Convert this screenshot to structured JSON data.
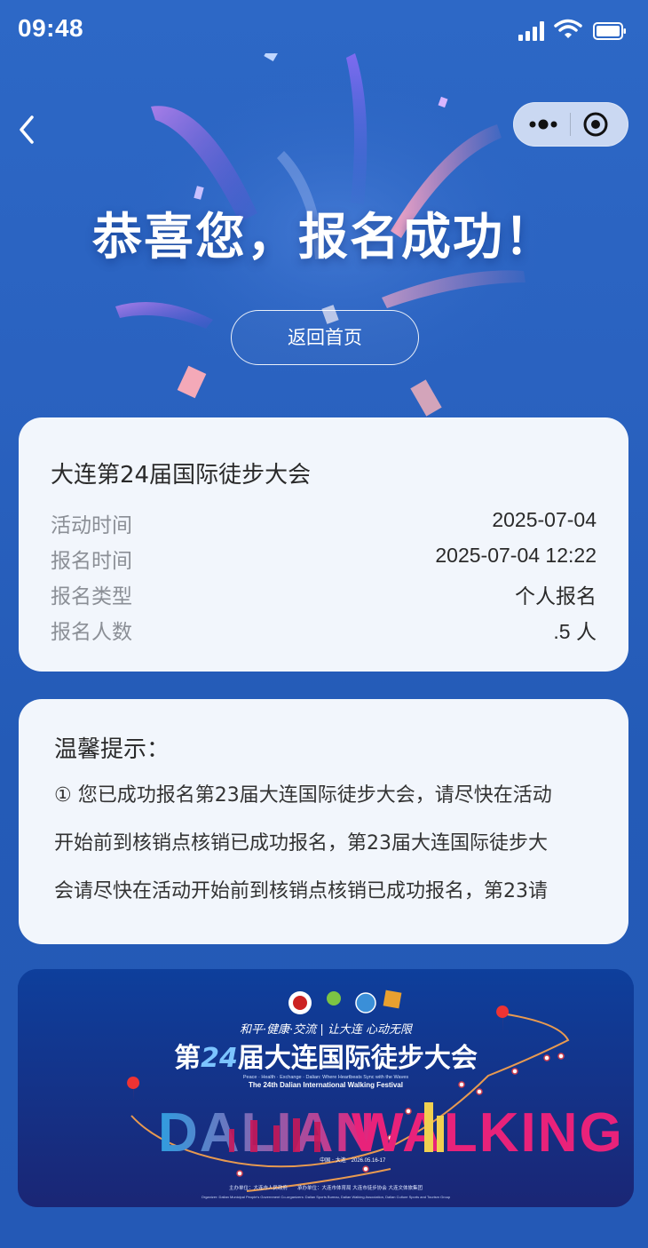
{
  "status_bar": {
    "time": "09:48"
  },
  "colors": {
    "background": "#2a62c0",
    "card": "#f2f6fc",
    "accent_pink": "#e8227a"
  },
  "headline": "恭喜您，报名成功！",
  "home_button": "返回首页",
  "event": {
    "title": "大连第24届国际徒步大会",
    "rows": [
      {
        "label": "活动时间",
        "value": "2025-07-04"
      },
      {
        "label": "报名时间",
        "value": "2025-07-04 12:22"
      },
      {
        "label": "报名类型",
        "value": "个人报名"
      },
      {
        "label": "报名人数",
        "value": ".5 人"
      }
    ]
  },
  "tips": {
    "title": "温馨提示：",
    "lines": [
      "① 您已成功报名第23届大连国际徒步大会，请尽快在活动",
      "开始前到核销点核销已成功报名，第23届大连国际徒步大",
      "会请尽快在活动开始前到核销点核销已成功报名，第23请"
    ]
  },
  "banner": {
    "slogan": "和平·健康·交流 | 让大连 心动无限",
    "title_cn_pre": "第",
    "title_cn_num": "24",
    "title_cn_post": "届大连国际徒步大会",
    "subtitle_1": "Peace · Health · Exchange · Dalian: Where Heartbeats Sync with the Waves",
    "subtitle_2": "The 24th Dalian International Walking Festival",
    "big_left": "DALIAN",
    "big_right": "WALKING",
    "place": "中国 · 大连",
    "date": "2026.05.16-17",
    "organizers_cn": "主办单位：大连市人民政府　　承办单位：大连市体育局 大连市徒步协会 大连文体旅集团",
    "organizers_en": "Organizer: Dalian Municipal People's Government   Co-organizers: Dalian Sports Bureau, Dalian Walking Association, Dalian Culture Sports and Tourism Group"
  },
  "icons": [
    "signal-icon",
    "wifi-icon",
    "battery-icon",
    "back-icon",
    "more-icon",
    "close-target-icon"
  ]
}
